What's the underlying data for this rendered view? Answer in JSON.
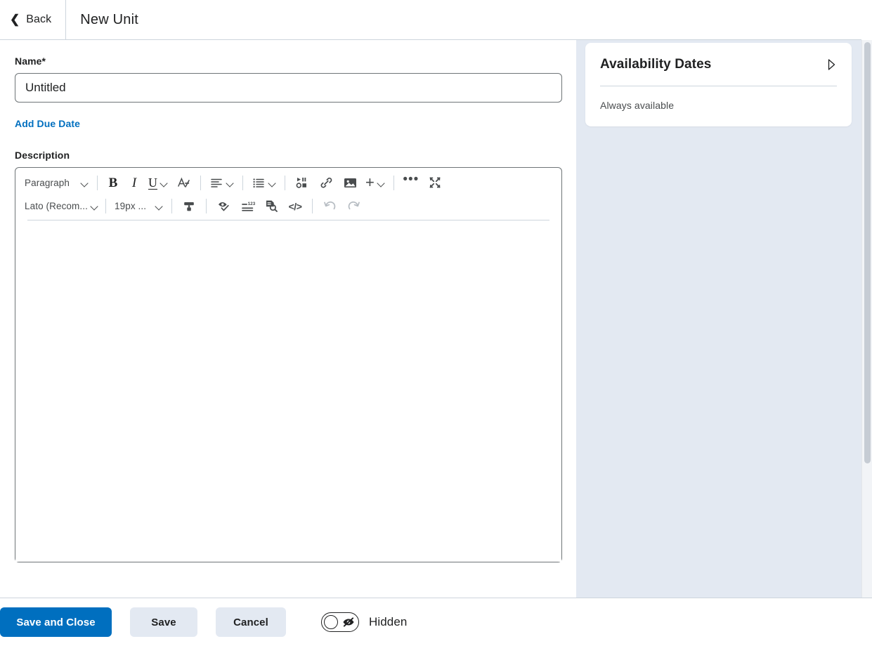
{
  "header": {
    "back_label": "Back",
    "title": "New Unit"
  },
  "form": {
    "name_label": "Name",
    "required_marker": "*",
    "name_value": "Untitled",
    "name_placeholder": "Untitled",
    "add_due_date_label": "Add Due Date",
    "description_label": "Description"
  },
  "editor": {
    "toolbar_row1": {
      "paragraph_style": "Paragraph",
      "bold": "B",
      "italic": "I",
      "underline": "U",
      "clear_formatting": "A/",
      "plus": "+",
      "more": "•••"
    },
    "toolbar_row2": {
      "font_family": "Lato (Recom...",
      "font_size": "19px ..."
    },
    "content": ""
  },
  "sidebar": {
    "card_title": "Availability Dates",
    "card_body": "Always available"
  },
  "footer": {
    "save_and_close": "Save and Close",
    "save": "Save",
    "cancel": "Cancel",
    "visibility_label": "Hidden",
    "visibility_state": "off"
  },
  "colors": {
    "accent": "#006fbf",
    "link": "#006fbf",
    "panel_bg": "#e3e9f2",
    "text": "#202122",
    "muted_text": "#494c4e",
    "border": "#6e7477",
    "divider": "#cdd5dc"
  }
}
